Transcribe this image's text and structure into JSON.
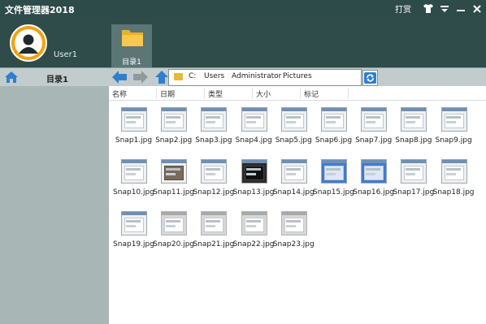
{
  "window": {
    "title": "文件管理器2018",
    "menu_label": "打赏"
  },
  "user": {
    "name": "User1"
  },
  "directory_tab": {
    "label": "目录1"
  },
  "sidebar": {
    "title": "目录1"
  },
  "address": {
    "path": [
      "C:",
      "Users",
      "Administrator",
      "Pictures"
    ]
  },
  "columns": [
    "名称",
    "日期",
    "类型",
    "大小",
    "标记"
  ],
  "files": [
    {
      "name": "Snap1.jpg",
      "style": "light"
    },
    {
      "name": "Snap2.jpg",
      "style": "light"
    },
    {
      "name": "Snap3.jpg",
      "style": "light"
    },
    {
      "name": "Snap4.jpg",
      "style": "light"
    },
    {
      "name": "Snap5.jpg",
      "style": "light"
    },
    {
      "name": "Snap6.jpg",
      "style": "light"
    },
    {
      "name": "Snap7.jpg",
      "style": "light"
    },
    {
      "name": "Snap8.jpg",
      "style": "light"
    },
    {
      "name": "Snap9.jpg",
      "style": "light"
    },
    {
      "name": "Snap10.jpg",
      "style": "light"
    },
    {
      "name": "Snap11.jpg",
      "style": "card"
    },
    {
      "name": "Snap12.jpg",
      "style": "light"
    },
    {
      "name": "Snap13.jpg",
      "style": "dark"
    },
    {
      "name": "Snap14.jpg",
      "style": "light"
    },
    {
      "name": "Snap15.jpg",
      "style": "blue"
    },
    {
      "name": "Snap16.jpg",
      "style": "blue"
    },
    {
      "name": "Snap17.jpg",
      "style": "light"
    },
    {
      "name": "Snap18.jpg",
      "style": "light"
    },
    {
      "name": "Snap19.jpg",
      "style": "light"
    },
    {
      "name": "Snap20.jpg",
      "style": "grey"
    },
    {
      "name": "Snap21.jpg",
      "style": "grey"
    },
    {
      "name": "Snap22.jpg",
      "style": "grey"
    },
    {
      "name": "Snap23.jpg",
      "style": "grey"
    }
  ],
  "colors": {
    "titlebar": "#2d4b49",
    "header": "#2f4b4a",
    "sidebar": "#a9b6b6",
    "accent_blue": "#2f7fd0",
    "avatar": "#f5a10a"
  },
  "icons": [
    "user-avatar-icon",
    "folder-icon",
    "home-icon",
    "back-arrow-icon",
    "forward-arrow-icon",
    "up-arrow-icon",
    "refresh-icon",
    "shirt-icon",
    "menu-icon",
    "minimize-icon",
    "close-icon"
  ]
}
